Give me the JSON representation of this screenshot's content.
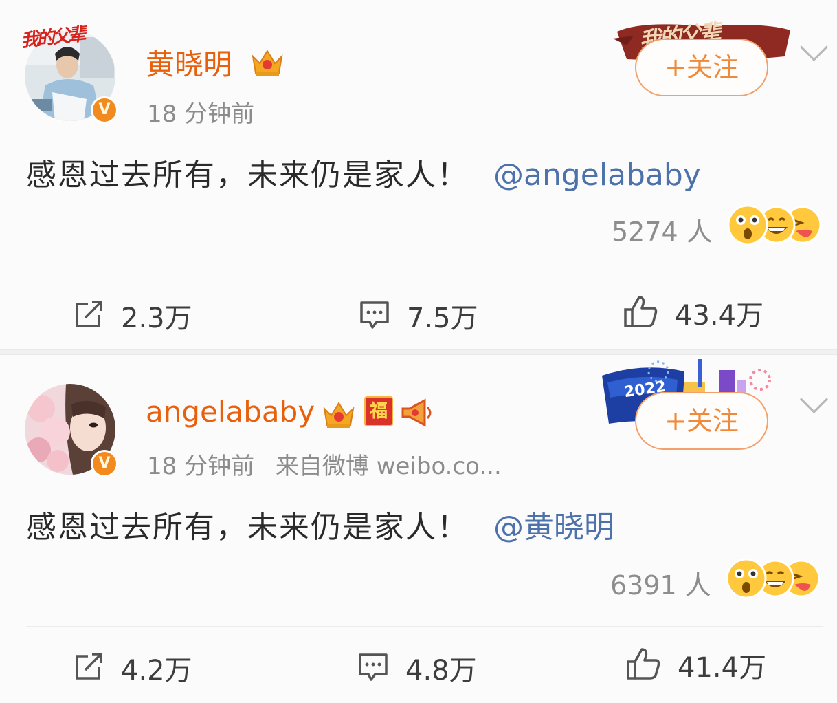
{
  "posts": [
    {
      "avatar_banner": "我的父辈",
      "name": "黄晓明",
      "verified_badge": "V",
      "time": "18 分钟前",
      "source": "",
      "text": "感恩过去所有，未来仍是家人！",
      "mention": "@angelababy",
      "follow_label": "+关注",
      "card_banner": "我的父辈",
      "reaction_count": "5274 人",
      "reaction_icons": [
        "surprised-emoji",
        "laughing-emoji",
        "tongue-emoji"
      ],
      "repost_count": "2.3万",
      "comment_count": "7.5万",
      "like_count": "43.4万",
      "colors": {
        "name": "#e8600b",
        "mention": "#4d72ab",
        "follow": "#f08a3a"
      }
    },
    {
      "name": "angelababy",
      "verified_badge": "V",
      "time": "18 分钟前",
      "source": "来自微博 weibo.co...",
      "text": "感恩过去所有，未来仍是家人！",
      "mention": "@黄晓明",
      "follow_label": "+关注",
      "badge_fu": "福",
      "card_banner": "2022",
      "reaction_count": "6391 人",
      "reaction_icons": [
        "surprised-emoji",
        "laughing-emoji",
        "tongue-emoji"
      ],
      "repost_count": "4.2万",
      "comment_count": "4.8万",
      "like_count": "41.4万",
      "colors": {
        "name": "#e8600b",
        "mention": "#4d72ab",
        "follow": "#f08a3a"
      }
    }
  ]
}
